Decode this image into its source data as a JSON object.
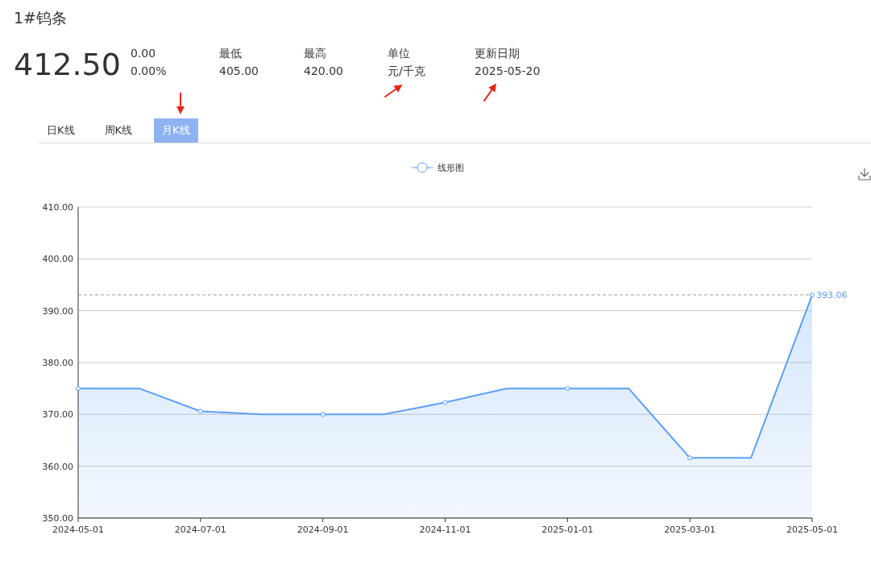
{
  "title": "1#钨条",
  "price": "412.50",
  "change": {
    "amount": "0.00",
    "percent": "0.00%"
  },
  "stats": [
    {
      "label": "最低",
      "value": "405.00",
      "arrow": false
    },
    {
      "label": "最高",
      "value": "420.00",
      "arrow": false
    },
    {
      "label": "单位",
      "value": "元/千克",
      "arrow": true
    },
    {
      "label": "更新日期",
      "value": "2025-05-20",
      "arrow": true
    }
  ],
  "tabs": [
    {
      "label": "日K线",
      "selected": false,
      "arrow": false
    },
    {
      "label": "周K线",
      "selected": false,
      "arrow": false
    },
    {
      "label": "月K线",
      "selected": true,
      "arrow": true
    }
  ],
  "chart_data": {
    "type": "area",
    "categories": [
      "2024-05-01",
      null,
      "2024-07-01",
      null,
      "2024-09-01",
      null,
      "2024-11-01",
      null,
      "2025-01-01",
      null,
      "2025-03-01",
      null,
      "2025-05-01"
    ],
    "series": [
      {
        "name": "线形图",
        "color": "#5b9ef5",
        "values": [
          375,
          375,
          370.6,
          370,
          370,
          370,
          372.3,
          375,
          375,
          375,
          361.6,
          361.6,
          393.06
        ]
      }
    ],
    "ylim": [
      350,
      410
    ],
    "yticks": [
      {
        "value": 350,
        "label": "350.00"
      },
      {
        "value": 360,
        "label": "360.00"
      },
      {
        "value": 370,
        "label": "370.00"
      },
      {
        "value": 380,
        "label": "380.00"
      },
      {
        "value": 390,
        "label": "390.00"
      },
      {
        "value": 400,
        "label": "400.00"
      },
      {
        "value": 410,
        "label": "410.00"
      }
    ],
    "grid": true,
    "ref_lines": [
      {
        "axis": "y",
        "value": 393.06,
        "label": "393.06"
      }
    ]
  }
}
